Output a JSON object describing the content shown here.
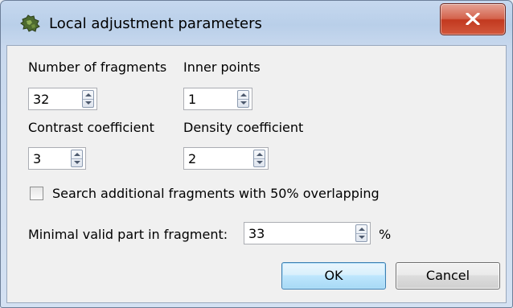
{
  "window": {
    "title": "Local adjustment parameters",
    "icon": "puzzle-icon",
    "close_icon": "close-x-icon"
  },
  "fields": {
    "fragments": {
      "label": "Number of fragments",
      "value": "32"
    },
    "inner_points": {
      "label": "Inner points",
      "value": "1"
    },
    "contrast": {
      "label": "Contrast coefficient",
      "value": "3"
    },
    "density": {
      "label": "Density coefficient",
      "value": "2"
    }
  },
  "search_additional": {
    "label": "Search additional fragments with 50% overlapping",
    "checked": false
  },
  "minimal_valid": {
    "label": "Minimal valid part in fragment:",
    "value": "33",
    "unit": "%"
  },
  "buttons": {
    "ok": "OK",
    "cancel": "Cancel"
  },
  "colors": {
    "accent": "#3c7fb1",
    "close_red": "#c2391f"
  }
}
